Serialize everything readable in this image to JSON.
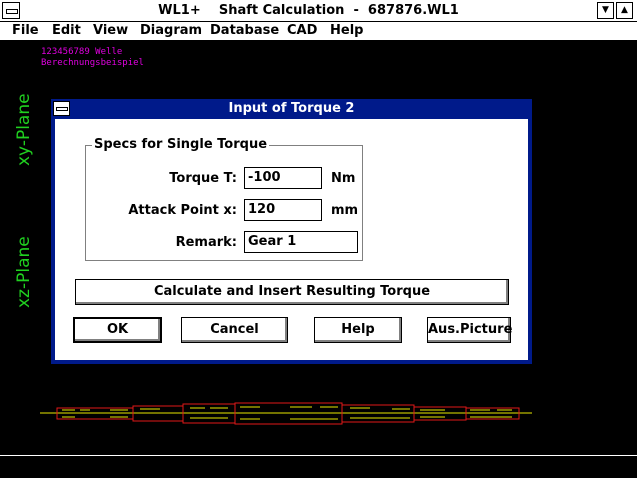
{
  "window": {
    "title": "WL1+    Shaft Calculation  -  687876.WL1",
    "minimize_glyph": "▼",
    "maximize_glyph": "▲"
  },
  "menu": {
    "items": [
      {
        "label": "File",
        "hotkey": "F"
      },
      {
        "label": "Edit",
        "hotkey": "E"
      },
      {
        "label": "View",
        "hotkey": "V"
      },
      {
        "label": "Diagram",
        "hotkey": ""
      },
      {
        "label": "Database",
        "hotkey": "D"
      },
      {
        "label": "CAD",
        "hotkey": "C"
      },
      {
        "label": "Help",
        "hotkey": "H"
      }
    ]
  },
  "canvas": {
    "line1": "123456789 Welle",
    "line2": "Berechnungsbeispiel",
    "xy_plane": "xy-Plane",
    "xz_plane": "xz-Plane"
  },
  "dialog": {
    "title": "Input of Torque 2",
    "group_title": "Specs for Single Torque",
    "torque_label": "Torque T:",
    "torque_value": "-100",
    "torque_unit": "Nm",
    "attack_label": "Attack Point x:",
    "attack_value": "120",
    "attack_unit": "mm",
    "remark_label": "Remark:",
    "remark_value": "Gear 1",
    "calc_button": "Calculate and Insert Resulting Torque",
    "ok_button": "OK",
    "cancel_button": "Cancel",
    "help_button": "Help",
    "picture_button": "Aus.Picture"
  },
  "colors": {
    "dialog_title_bg": "#001a8a",
    "plane_label": "#20d020",
    "header_text": "#e000e0",
    "shaft_outline": "#e01818",
    "shaft_axis": "#e8e800"
  }
}
